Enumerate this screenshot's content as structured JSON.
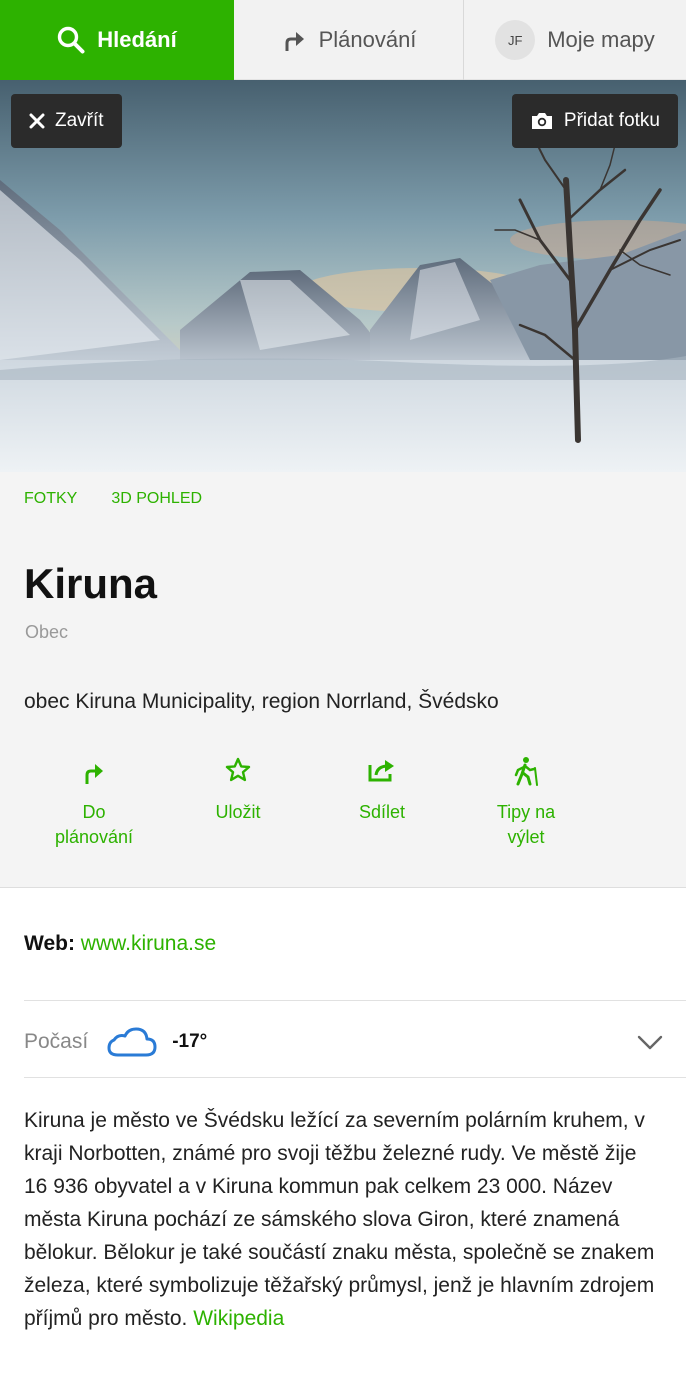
{
  "nav": {
    "search_label": "Hledání",
    "plan_label": "Plánování",
    "avatar_initials": "JF",
    "maps_label": "Moje mapy"
  },
  "hero": {
    "close_label": "Zavřít",
    "add_photo_label": "Přidat fotku"
  },
  "place": {
    "links": [
      "FOTKY",
      "3D POHLED"
    ],
    "title": "Kiruna",
    "type": "Obec",
    "address": "obec Kiruna Municipality, region Norrland, Švédsko"
  },
  "actions": [
    {
      "line1": "Do",
      "line2": "plánování",
      "icon": "route-arrow-icon"
    },
    {
      "line1": "Uložit",
      "line2": "",
      "icon": "star-icon"
    },
    {
      "line1": "Sdílet",
      "line2": "",
      "icon": "share-icon"
    },
    {
      "line1": "Tipy na",
      "line2": "výlet",
      "icon": "hiking-icon"
    }
  ],
  "web": {
    "label": "Web:",
    "url": "www.kiruna.se"
  },
  "weather": {
    "label": "Počasí",
    "icon": "cloud-icon",
    "temperature": "-17°"
  },
  "description": {
    "text": "Kiruna je město ve Švédsku ležící za severním polárním kruhem, v kraji Norbotten, známé pro svoji těžbu železné rudy. Ve městě žije 16 936 obyvatel a v Kiruna kommun pak celkem 23 000. Název města Kiruna pochází ze sámského slova Giron, které znamená bělokur. Bělokur je také součástí znaku města, společně se znakem železa, které symbolizuje těžařský průmysl, jenž je hlavním zdrojem příjmů pro město.",
    "source_label": "Wikipedia"
  },
  "colors": {
    "accent": "#2db200",
    "weather_icon": "#2a7bd6"
  }
}
